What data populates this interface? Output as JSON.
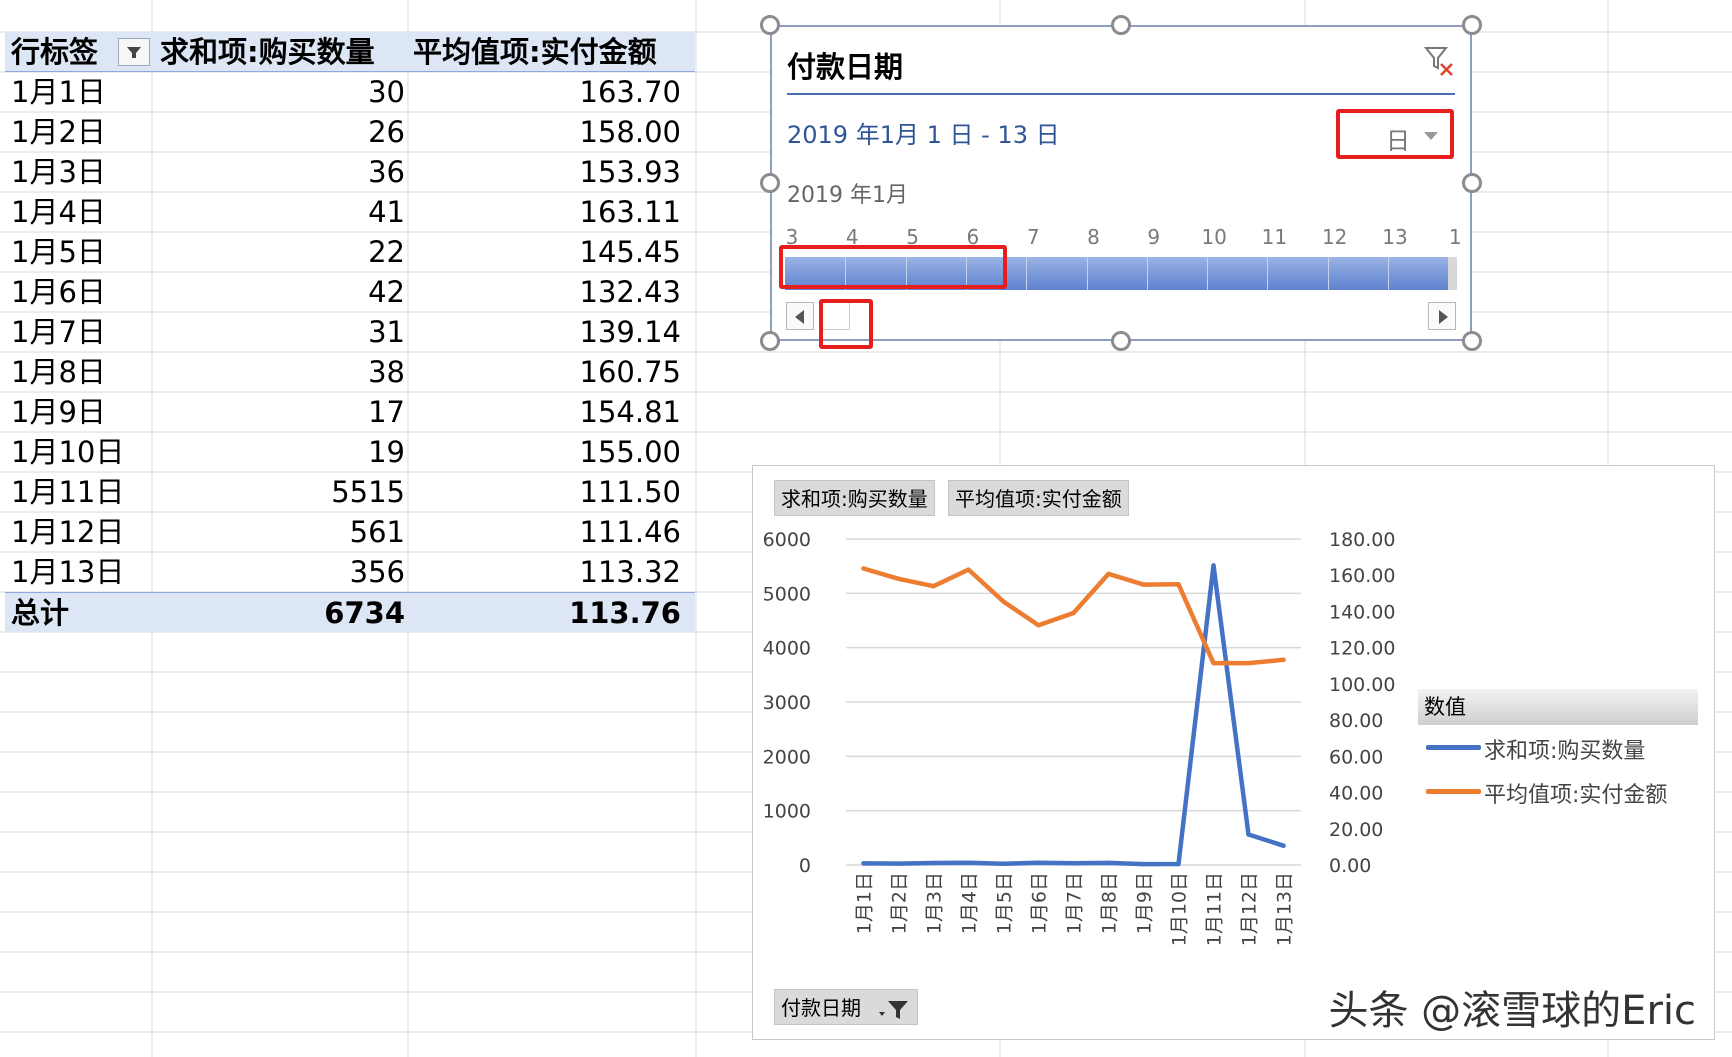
{
  "pivot_table": {
    "header": {
      "row_label": "行标签",
      "col_quantity": "求和项:购买数量",
      "col_amount": "平均值项:实付金额"
    },
    "rows": [
      {
        "label": "1月1日",
        "quantity": "30",
        "amount": "163.70"
      },
      {
        "label": "1月2日",
        "quantity": "26",
        "amount": "158.00"
      },
      {
        "label": "1月3日",
        "quantity": "36",
        "amount": "153.93"
      },
      {
        "label": "1月4日",
        "quantity": "41",
        "amount": "163.11"
      },
      {
        "label": "1月5日",
        "quantity": "22",
        "amount": "145.45"
      },
      {
        "label": "1月6日",
        "quantity": "42",
        "amount": "132.43"
      },
      {
        "label": "1月7日",
        "quantity": "31",
        "amount": "139.14"
      },
      {
        "label": "1月8日",
        "quantity": "38",
        "amount": "160.75"
      },
      {
        "label": "1月9日",
        "quantity": "17",
        "amount": "154.81"
      },
      {
        "label": "1月10日",
        "quantity": "19",
        "amount": "155.00"
      },
      {
        "label": "1月11日",
        "quantity": "5515",
        "amount": "111.50"
      },
      {
        "label": "1月12日",
        "quantity": "561",
        "amount": "111.46"
      },
      {
        "label": "1月13日",
        "quantity": "356",
        "amount": "113.32"
      }
    ],
    "total": {
      "label": "总计",
      "quantity": "6734",
      "amount": "113.76"
    }
  },
  "timeline": {
    "title": "付款日期",
    "range": "2019 年1月 1 日 - 13 日",
    "level": "日",
    "year_month": "2019 年1月",
    "ticks": [
      "3",
      "4",
      "5",
      "6",
      "7",
      "8",
      "9",
      "10",
      "11",
      "12",
      "13",
      "1"
    ],
    "clear_filter_icon": "clear-filter-icon"
  },
  "chart": {
    "field_button_quantity": "求和项:购买数量",
    "field_button_amount": "平均值项:实付金额",
    "filter_field": "付款日期",
    "legend_title": "数值",
    "colors": {
      "quantity": "#4472c4",
      "amount": "#ed7d31"
    }
  },
  "chart_data": {
    "type": "line",
    "categories": [
      "1月1日",
      "1月2日",
      "1月3日",
      "1月4日",
      "1月5日",
      "1月6日",
      "1月7日",
      "1月8日",
      "1月9日",
      "1月10日",
      "1月11日",
      "1月12日",
      "1月13日"
    ],
    "series": [
      {
        "name": "求和项:购买数量",
        "axis": "left",
        "values": [
          30,
          26,
          36,
          41,
          22,
          42,
          31,
          38,
          17,
          19,
          5515,
          561,
          356
        ]
      },
      {
        "name": "平均值项:实付金额",
        "axis": "right",
        "values": [
          163.7,
          158.0,
          153.93,
          163.11,
          145.45,
          132.43,
          139.14,
          160.75,
          154.81,
          155.0,
          111.5,
          111.46,
          113.32
        ]
      }
    ],
    "y_left": {
      "min": 0,
      "max": 6000,
      "ticks": [
        "6000",
        "5000",
        "4000",
        "3000",
        "2000",
        "1000",
        "0"
      ]
    },
    "y_right": {
      "min": 0,
      "max": 180,
      "ticks": [
        "180.00",
        "160.00",
        "140.00",
        "120.00",
        "100.00",
        "80.00",
        "60.00",
        "40.00",
        "20.00",
        "0.00"
      ]
    },
    "grid": true,
    "legend_position": "right"
  },
  "watermark": "头条 @滚雪球的Eric"
}
